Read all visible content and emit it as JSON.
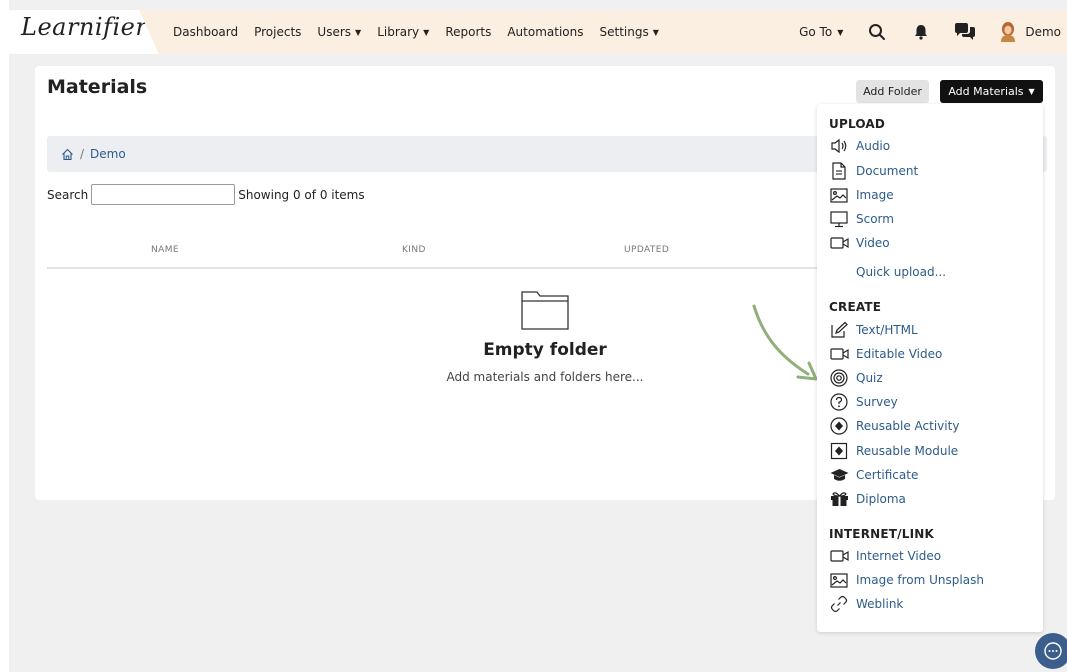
{
  "header": {
    "logo": "Learnifier",
    "nav": [
      {
        "label": "Dashboard",
        "dropdown": false
      },
      {
        "label": "Projects",
        "dropdown": false
      },
      {
        "label": "Users",
        "dropdown": true
      },
      {
        "label": "Library",
        "dropdown": true
      },
      {
        "label": "Reports",
        "dropdown": false
      },
      {
        "label": "Automations",
        "dropdown": false
      },
      {
        "label": "Settings",
        "dropdown": true
      }
    ],
    "goto_label": "Go To",
    "user_name": "Demo"
  },
  "page": {
    "title": "Materials",
    "add_folder_label": "Add Folder",
    "add_materials_label": "Add Materials",
    "breadcrumb": [
      "Demo"
    ],
    "search_label": "Search",
    "search_value": "",
    "showing_text": "Showing 0 of 0 items",
    "columns": [
      "NAME",
      "KIND",
      "UPDATED"
    ],
    "empty_title": "Empty folder",
    "empty_subtitle": "Add materials and folders here..."
  },
  "dropdown": {
    "sections": [
      {
        "title": "UPLOAD",
        "items": [
          {
            "label": "Audio",
            "icon": "audio-icon"
          },
          {
            "label": "Document",
            "icon": "document-icon"
          },
          {
            "label": "Image",
            "icon": "image-icon"
          },
          {
            "label": "Scorm",
            "icon": "monitor-icon"
          },
          {
            "label": "Video",
            "icon": "video-icon"
          },
          {
            "label": "Quick upload...",
            "icon": ""
          }
        ]
      },
      {
        "title": "CREATE",
        "items": [
          {
            "label": "Text/HTML",
            "icon": "edit-icon"
          },
          {
            "label": "Editable Video",
            "icon": "video-icon"
          },
          {
            "label": "Quiz",
            "icon": "target-icon"
          },
          {
            "label": "Survey",
            "icon": "question-icon"
          },
          {
            "label": "Reusable Activity",
            "icon": "diamond-circle-icon"
          },
          {
            "label": "Reusable Module",
            "icon": "diamond-square-icon"
          },
          {
            "label": "Certificate",
            "icon": "graduation-cap-icon"
          },
          {
            "label": "Diploma",
            "icon": "gift-icon"
          }
        ]
      },
      {
        "title": "INTERNET/LINK",
        "items": [
          {
            "label": "Internet Video",
            "icon": "video-icon"
          },
          {
            "label": "Image from Unsplash",
            "icon": "image-icon"
          },
          {
            "label": "Weblink",
            "icon": "link-icon"
          }
        ]
      }
    ]
  },
  "colors": {
    "nav_bg": "#fbefe2",
    "link": "#2d5b8a",
    "arrow": "#8fb07a",
    "chat": "#3b5e8c"
  }
}
